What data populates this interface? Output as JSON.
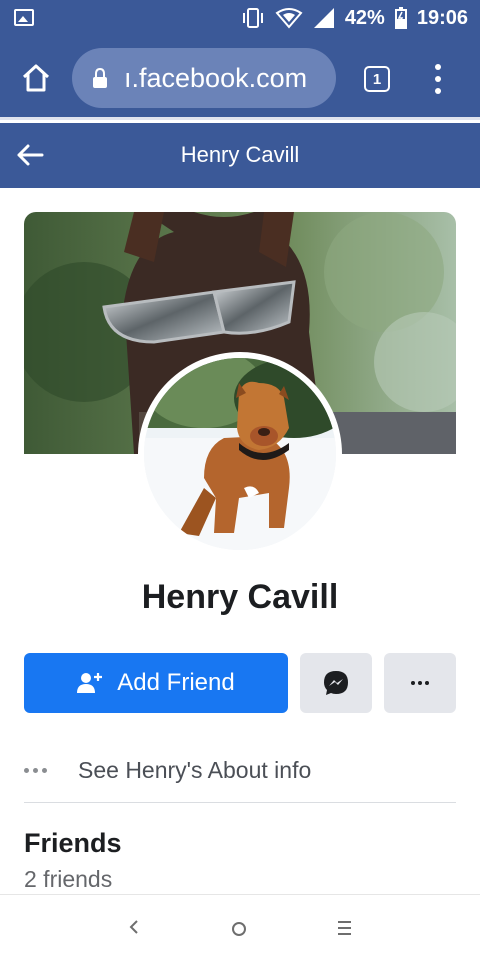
{
  "status_bar": {
    "battery": "42%",
    "time": "19:06",
    "icons": [
      "gallery-icon",
      "vibrate-icon",
      "hotspot-icon",
      "signal-icon",
      "battery-icon"
    ]
  },
  "browser": {
    "url": "ı.facebook.com",
    "tab_count": "1",
    "icons": [
      "home-icon",
      "lock-icon",
      "menu-icon"
    ]
  },
  "header": {
    "title": "Henry Cavill",
    "back_icon": "back-arrow-icon"
  },
  "profile": {
    "name": "Henry Cavill",
    "cover_image": "dog wearing sunglasses",
    "avatar_image": "brown dog standing in snow"
  },
  "actions": {
    "add_friend_label": "Add Friend",
    "add_friend_icon": "add-person-icon",
    "message_icon": "messenger-icon",
    "more_icon": "more-icon"
  },
  "about": {
    "label": "See Henry's About info"
  },
  "friends": {
    "title": "Friends",
    "count": "2 friends"
  },
  "navigation": {
    "icons": [
      "back-icon",
      "home-icon",
      "recents-icon"
    ]
  },
  "colors": {
    "brand": "#3b5998",
    "button_blue": "#1877f2",
    "button_gray": "#e4e6eb"
  }
}
